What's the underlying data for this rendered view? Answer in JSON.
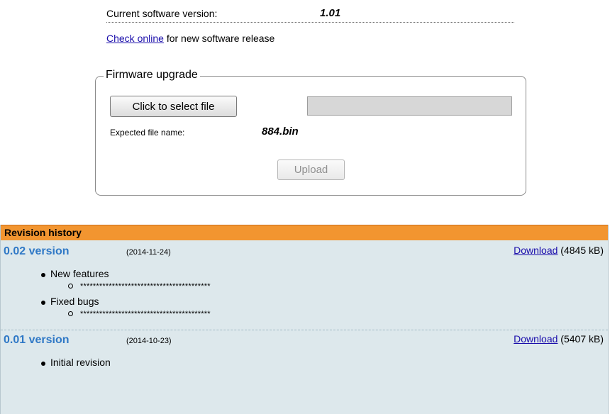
{
  "software": {
    "version_label": "Current software version:",
    "version_value": "1.01",
    "check_link": "Check online",
    "check_suffix": " for new software release"
  },
  "firmware": {
    "legend": "Firmware upgrade",
    "select_button": "Click to select file",
    "file_field_value": "",
    "expected_label": "Expected file name:",
    "expected_value": "884.bin",
    "upload_button": "Upload"
  },
  "revision_history": {
    "title": "Revision history",
    "entries": [
      {
        "version": "0.02 version",
        "date": "(2014-11-24)",
        "download_label": "Download",
        "download_size": " (4845 kB)",
        "items": [
          {
            "label": "New features",
            "sub": "*****************************************"
          },
          {
            "label": "Fixed bugs",
            "sub": "*****************************************"
          }
        ]
      },
      {
        "version": "0.01 version",
        "date": "(2014-10-23)",
        "download_label": "Download",
        "download_size": " (5407 kB)",
        "items": [
          {
            "label": "Initial revision"
          }
        ]
      }
    ]
  },
  "colors": {
    "header_orange": "#f29530",
    "panel_bg": "#dde8ec",
    "version_blue": "#2f78c6",
    "link_blue": "#1a0dab"
  }
}
